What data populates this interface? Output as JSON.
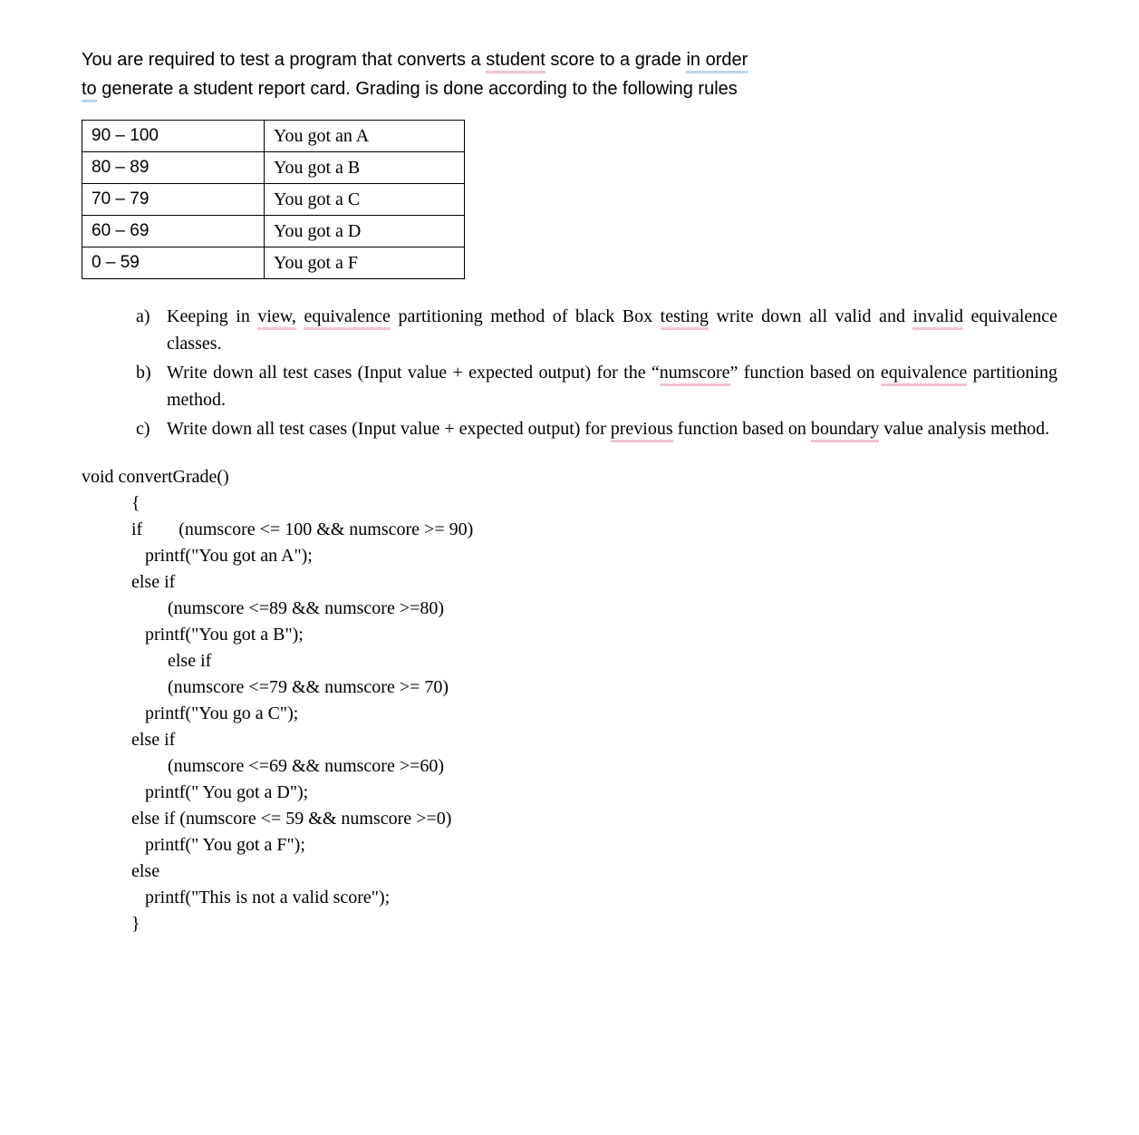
{
  "intro": {
    "seg1": "You are required to test a program that converts a ",
    "hl_student": "student",
    "seg2": " score to a grade ",
    "hl_in_order": "in order",
    "seg3a": "",
    "hl_to": "to",
    "seg3b": " generate a student report card. Grading is done according to the following rules"
  },
  "grading_table": [
    {
      "range": "90 – 100",
      "msg": "You got an A"
    },
    {
      "range": "80 – 89",
      "msg": "You got a B"
    },
    {
      "range": "70 – 79",
      "msg": "You got a C"
    },
    {
      "range": "60 – 69",
      "msg": "You got a D"
    },
    {
      "range": "0 – 59",
      "msg": "You got a F"
    }
  ],
  "questions": {
    "a": {
      "marker": "a)",
      "seg1": "Keeping in ",
      "hl_view": "view,",
      "seg2": " ",
      "hl_equivalence": "equivalence",
      "seg3": " partitioning method of black Box ",
      "hl_testing": "testing",
      "seg4": " write down all valid and ",
      "hl_invalid": "invalid",
      "seg5": " equivalence classes."
    },
    "b": {
      "marker": "b)",
      "seg1": "Write down all test cases (Input value + expected output) for the “",
      "hl_numscore": "numscore",
      "seg2": "” function based on ",
      "hl_equivalence": "equivalence",
      "seg3": " partitioning method."
    },
    "c": {
      "marker": "c)",
      "seg1": "Write down all test cases (Input value + expected output) for ",
      "hl_previous": "previous",
      "seg2": " function based on ",
      "hl_boundary": "boundary",
      "seg3": " value analysis method."
    }
  },
  "code_lines": [
    "void convertGrade()",
    "           {",
    "           if        (numscore <= 100 && numscore >= 90)",
    "              printf(\"You got an A\");",
    "           else if",
    "                   (numscore <=89 && numscore >=80)",
    "              printf(\"You got a B\");",
    "                   else if",
    "                   (numscore <=79 && numscore >= 70)",
    "              printf(\"You go a C\");",
    "           else if",
    "                   (numscore <=69 && numscore >=60)",
    "              printf(\" You got a D\");",
    "           else if (numscore <= 59 && numscore >=0)",
    "              printf(\" You got a F\");",
    "           else",
    "              printf(\"This is not a valid score\");",
    "           }"
  ]
}
